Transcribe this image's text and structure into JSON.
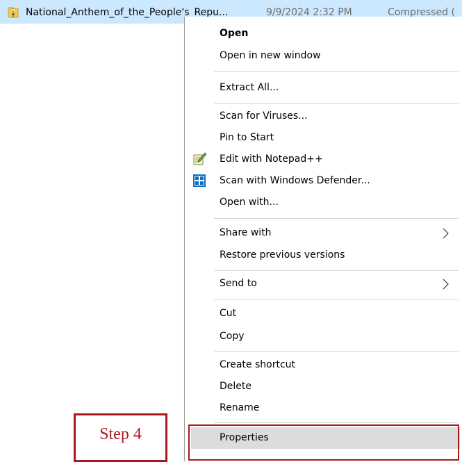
{
  "file": {
    "name": "National_Anthem_of_the_People's_Repu...",
    "date": "9/9/2024 2:32 PM",
    "type": "Compressed (",
    "icon": "zip-folder-icon"
  },
  "menu": {
    "items": [
      {
        "label": "Open"
      },
      {
        "label": "Open in new window"
      },
      {
        "label": "Extract All..."
      },
      {
        "label": "Scan for Viruses..."
      },
      {
        "label": "Pin to Start"
      },
      {
        "label": "Edit with Notepad++",
        "icon": "notepad-plus-plus-icon"
      },
      {
        "label": "Scan with Windows Defender...",
        "icon": "windows-defender-icon"
      },
      {
        "label": "Open with..."
      },
      {
        "label": "Share with"
      },
      {
        "label": "Restore previous versions"
      },
      {
        "label": "Send to"
      },
      {
        "label": "Cut"
      },
      {
        "label": "Copy"
      },
      {
        "label": "Create shortcut"
      },
      {
        "label": "Delete"
      },
      {
        "label": "Rename"
      },
      {
        "label": "Properties"
      }
    ]
  },
  "annotation": {
    "label": "Step 4",
    "color": "#a8191e"
  },
  "colors": {
    "selection": "#cce8ff",
    "hover": "#dcdcdc",
    "separator": "#d7d7d7"
  }
}
